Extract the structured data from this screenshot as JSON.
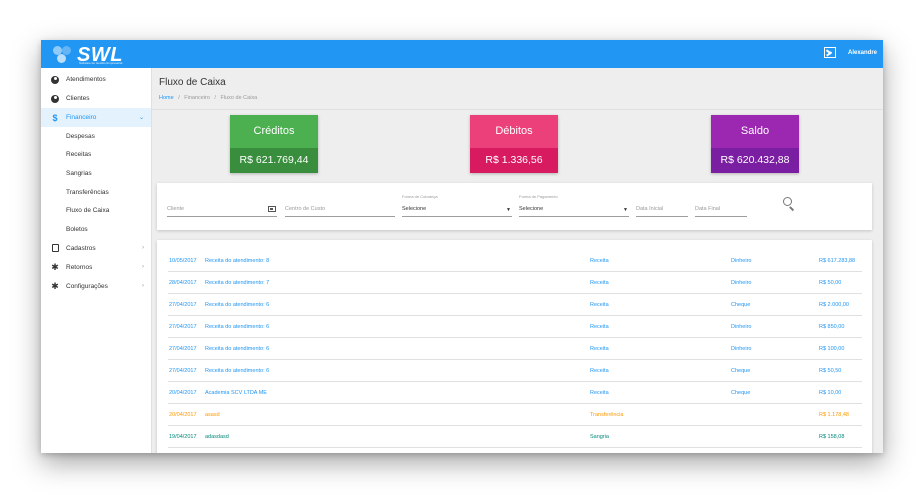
{
  "app": {
    "logo_text": "SWL",
    "logo_tagline": "Software de Gestão Empresarial",
    "user_name": "Alexandre"
  },
  "colors": {
    "primary": "#2196f3",
    "credit": "#4caf50",
    "debit": "#ec407a",
    "balance": "#9c27b0",
    "transfer": "#ff9800",
    "sangria": "#00897b"
  },
  "sidebar": {
    "items": [
      {
        "label": "Atendimentos",
        "icon": "person-icon"
      },
      {
        "label": "Clientes",
        "icon": "person-icon"
      },
      {
        "label": "Financeiro",
        "icon": "dollar-icon",
        "active": true
      },
      {
        "label": "Cadastros",
        "icon": "clipboard-icon"
      },
      {
        "label": "Retornos",
        "icon": "gear-icon"
      },
      {
        "label": "Configurações",
        "icon": "gear-icon"
      }
    ],
    "financeiro_sub": [
      {
        "label": "Despesas"
      },
      {
        "label": "Receitas"
      },
      {
        "label": "Sangrias"
      },
      {
        "label": "Transferências"
      },
      {
        "label": "Fluxo de Caixa"
      },
      {
        "label": "Boletos"
      }
    ]
  },
  "page": {
    "title": "Fluxo de Caixa",
    "breadcrumb": {
      "home": "Home",
      "sep": "/",
      "section": "Financeiro",
      "current": "Fluxo de Caixa"
    }
  },
  "summary": {
    "credits": {
      "title": "Créditos",
      "value": "R$ 621.769,44"
    },
    "debits": {
      "title": "Débitos",
      "value": "R$ 1.336,56"
    },
    "balance": {
      "title": "Saldo",
      "value": "R$ 620.432,88"
    }
  },
  "filters": {
    "cliente_placeholder": "Cliente",
    "centro_custo_placeholder": "Centro de Custo",
    "forma_cobranca_label": "Forma de Cobrança",
    "forma_cobranca_value": "Selecione",
    "forma_pagamento_label": "Forma de Pagamento",
    "forma_pagamento_value": "Selecione",
    "data_inicial_placeholder": "Data Inicial",
    "data_final_placeholder": "Data Final"
  },
  "transactions": [
    {
      "date": "10/05/2017",
      "description": "Receita do atendimento: 8",
      "type": "Receita",
      "method": "Dinheiro",
      "amount": "R$ 617.283,88",
      "color": "#2196f3"
    },
    {
      "date": "28/04/2017",
      "description": "Receita do atendimento: 7",
      "type": "Receita",
      "method": "Dinheiro",
      "amount": "R$ 50,00",
      "color": "#2196f3"
    },
    {
      "date": "27/04/2017",
      "description": "Receita do atendimento: 6",
      "type": "Receita",
      "method": "Cheque",
      "amount": "R$ 2.000,00",
      "color": "#2196f3"
    },
    {
      "date": "27/04/2017",
      "description": "Receita do atendimento: 6",
      "type": "Receita",
      "method": "Dinheiro",
      "amount": "R$ 850,00",
      "color": "#2196f3"
    },
    {
      "date": "27/04/2017",
      "description": "Receita do atendimento: 6",
      "type": "Receita",
      "method": "Dinheiro",
      "amount": "R$ 100,00",
      "color": "#2196f3"
    },
    {
      "date": "27/04/2017",
      "description": "Receita do atendimento: 6",
      "type": "Receita",
      "method": "Cheque",
      "amount": "R$ 50,50",
      "color": "#2196f3"
    },
    {
      "date": "20/04/2017",
      "description": "Academia SCV LTDA ME",
      "type": "Receita",
      "method": "Cheque",
      "amount": "R$ 10,00",
      "color": "#2196f3"
    },
    {
      "date": "20/04/2017",
      "description": "asasd",
      "type": "Transferência",
      "method": "",
      "amount": "R$ 1.178,48",
      "color": "#ff9800"
    },
    {
      "date": "19/04/2017",
      "description": "adasdasd",
      "type": "Sangria",
      "method": "",
      "amount": "R$ 158,08",
      "color": "#00897b"
    }
  ]
}
